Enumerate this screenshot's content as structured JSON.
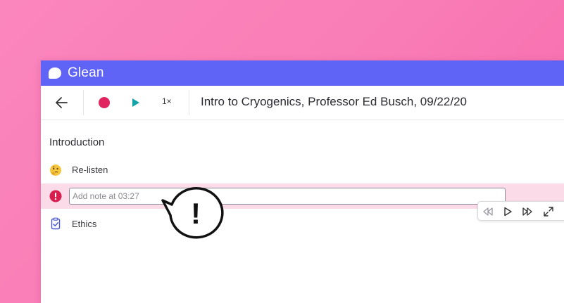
{
  "app": {
    "name": "Glean",
    "logo_icon": "glean-logo-icon",
    "brand_color": "#5f63f6",
    "record_color": "#e02460",
    "play_color": "#14a3a9"
  },
  "toolbar": {
    "back_icon": "arrow-left-icon",
    "record_icon": "record-icon",
    "play_icon": "play-icon",
    "speed_label": "1×",
    "title": "Intro to Cryogenics, Professor Ed Busch, 09/22/20"
  },
  "section": {
    "title": "Introduction"
  },
  "rows": [
    {
      "icon": "thinking-face-icon",
      "label": "Re-listen"
    },
    {
      "icon": "exclamation-circle-icon",
      "input_placeholder": "Add note at 03:27",
      "input_value": "",
      "highlight_color": "#fbdbe7"
    },
    {
      "icon": "clipboard-check-icon",
      "label": "Ethics"
    }
  ],
  "mini_player": {
    "buttons": [
      "rewind-icon",
      "play-outline-icon",
      "fast-forward-icon",
      "expand-icon"
    ]
  },
  "callout": {
    "icon": "exclamation-speech-bubble-icon",
    "symbol": "!"
  }
}
